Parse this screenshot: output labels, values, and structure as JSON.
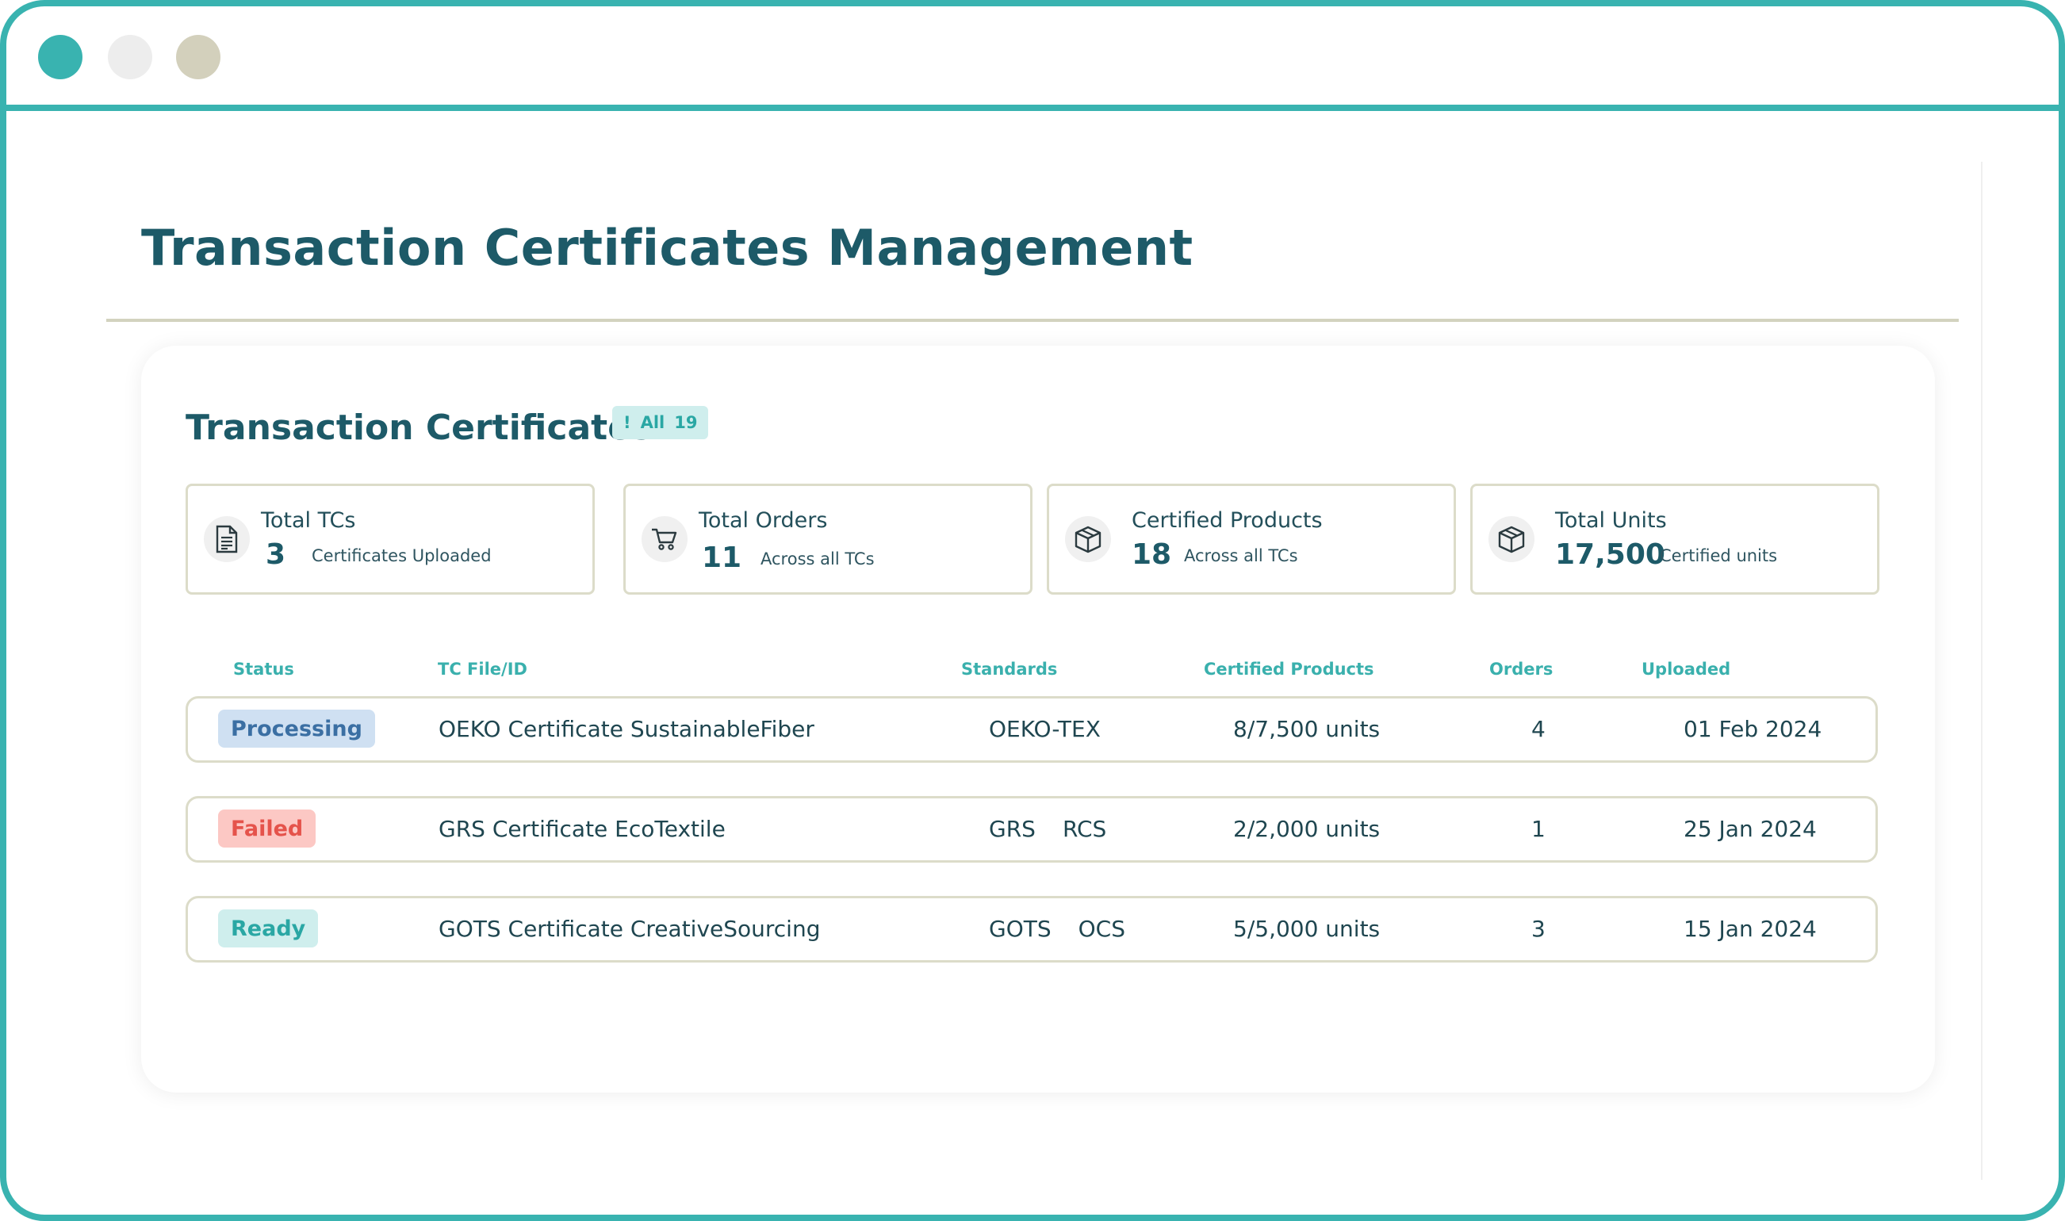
{
  "window": {
    "controls": [
      "window-dot-teal",
      "window-dot-light",
      "window-dot-beige"
    ]
  },
  "page": {
    "title": "Transaction Certificates Management"
  },
  "panel": {
    "title": "Transaction Certificates",
    "filter": {
      "icon": "!",
      "label": "All",
      "count": "19"
    }
  },
  "stats": [
    {
      "label": "Total TCs",
      "value": "3",
      "sub": "Certificates Uploaded",
      "icon": "document-icon"
    },
    {
      "label": "Total Orders",
      "value": "11",
      "sub": "Across all TCs",
      "icon": "cart-icon"
    },
    {
      "label": "Certified Products",
      "value": "18",
      "sub": "Across all TCs",
      "icon": "box-icon"
    },
    {
      "label": "Total Units",
      "value": "17,500",
      "sub": "Certified units",
      "icon": "box-icon"
    }
  ],
  "table": {
    "columns": [
      "Status",
      "TC File/ID",
      "Standards",
      "Certified Products",
      "Orders",
      "Uploaded"
    ],
    "rows": [
      {
        "status": "Processing",
        "tc": "OEKO Certificate SustainableFiber",
        "standards": [
          "OEKO-TEX"
        ],
        "products": "8/7,500 units",
        "orders": "4",
        "uploaded": "01 Feb 2024"
      },
      {
        "status": "Failed",
        "tc": "GRS Certificate EcoTextile",
        "standards": [
          "GRS",
          "RCS"
        ],
        "products": "2/2,000 units",
        "orders": "1",
        "uploaded": "25 Jan 2024"
      },
      {
        "status": "Ready",
        "tc": "GOTS Certificate CreativeSourcing",
        "standards": [
          "GOTS",
          "OCS"
        ],
        "products": "5/5,000 units",
        "orders": "3",
        "uploaded": "15 Jan 2024"
      }
    ]
  },
  "colors": {
    "accent": "#39b3b0",
    "title": "#1d5a68",
    "status_processing_bg": "#cfe0f2",
    "status_processing_fg": "#3b6fa3",
    "status_failed_bg": "#fcc8c4",
    "status_failed_fg": "#e5534b",
    "status_ready_bg": "#cfeeed",
    "status_ready_fg": "#2aa7a4"
  }
}
